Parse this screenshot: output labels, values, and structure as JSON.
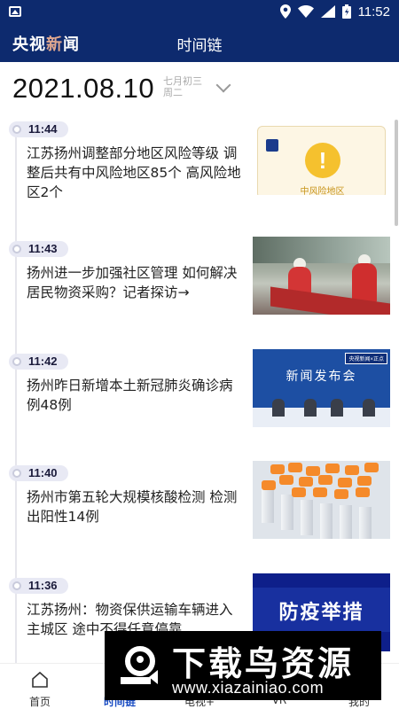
{
  "status_bar": {
    "time": "11:52"
  },
  "header": {
    "logo_main": "央视",
    "logo_accent": "新",
    "logo_tail": "闻",
    "title": "时间链"
  },
  "date": {
    "full": "2021.08.10",
    "lunar": "七月初三",
    "weekday": "周二"
  },
  "feed": [
    {
      "time": "11:44",
      "title": "江苏扬州调整部分地区风险等级 调整后共有中风险地区85个 高风险地区2个",
      "thumb": {
        "risk_label": "中风险地区"
      }
    },
    {
      "time": "11:43",
      "title": "扬州进一步加强社区管理 如何解决居民物资采购？记者探访→"
    },
    {
      "time": "11:42",
      "title": "扬州昨日新增本土新冠肺炎确诊病例48例",
      "thumb": {
        "headline": "新闻发布会",
        "logo": "央视新闻×正点"
      }
    },
    {
      "time": "11:40",
      "title": "扬州市第五轮大规模核酸检测 检测出阳性14例"
    },
    {
      "time": "11:36",
      "title": "江苏扬州：物资保供运输车辆进入主城区 途中不得任意停靠",
      "thumb": {
        "headline": "防疫举措"
      }
    }
  ],
  "tabs": [
    {
      "label": "首页",
      "icon": "home-icon"
    },
    {
      "label": "时间链",
      "icon": "timeline-icon"
    },
    {
      "label": "电视+",
      "icon": "tv-icon"
    },
    {
      "label": "VR",
      "icon": "vr-icon"
    },
    {
      "label": "我的",
      "icon": "profile-icon"
    }
  ],
  "watermark": {
    "title": "下载鸟资源",
    "url": "www.xiazainiao.com"
  },
  "colors": {
    "header_bg": "#0d2a6e",
    "accent": "#1d4fc4",
    "risk_yellow": "#f5c12e"
  }
}
